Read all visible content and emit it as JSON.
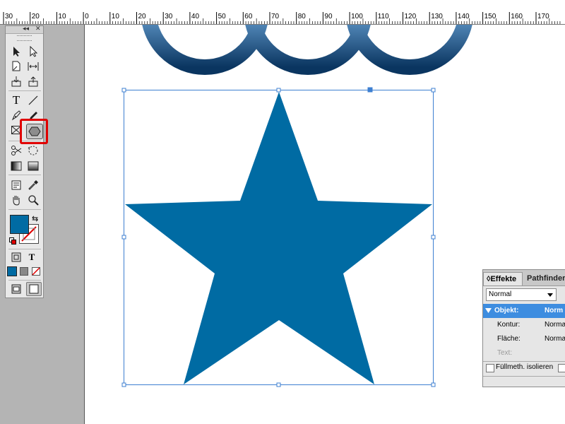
{
  "ruler": {
    "labels": [
      "30",
      "20",
      "10",
      "0",
      "10",
      "20",
      "30",
      "40",
      "50",
      "60",
      "70",
      "80",
      "90",
      "100",
      "110",
      "120",
      "130",
      "140",
      "150",
      "160",
      "170"
    ]
  },
  "tools_panel": {
    "collapse_glyph": "◂◂",
    "close_glyph": "✕",
    "type_tool_glyph": "T",
    "format_text_glyph": "T"
  },
  "colors": {
    "star_fill": "#006ba3",
    "ring_light": "#4a90c8",
    "ring_dark": "#0a3a66",
    "selection": "#3d7fd1",
    "highlight": "#e00000",
    "selected_row": "#3d8de0"
  },
  "effects_panel": {
    "tab_effects": "Effekte",
    "tab_pathfinder": "Pathfinder",
    "tab_effects_glyph": "◊",
    "blend_mode": "Normal",
    "rows": [
      {
        "key": "Objekt:",
        "value": "Norm",
        "selected": true
      },
      {
        "key": "Kontur:",
        "value": "Norma",
        "selected": false
      },
      {
        "key": "Fläche:",
        "value": "Norma",
        "selected": false
      },
      {
        "key": "Text:",
        "value": "",
        "selected": false
      }
    ],
    "isolate_label": "Füllmeth. isolieren"
  }
}
